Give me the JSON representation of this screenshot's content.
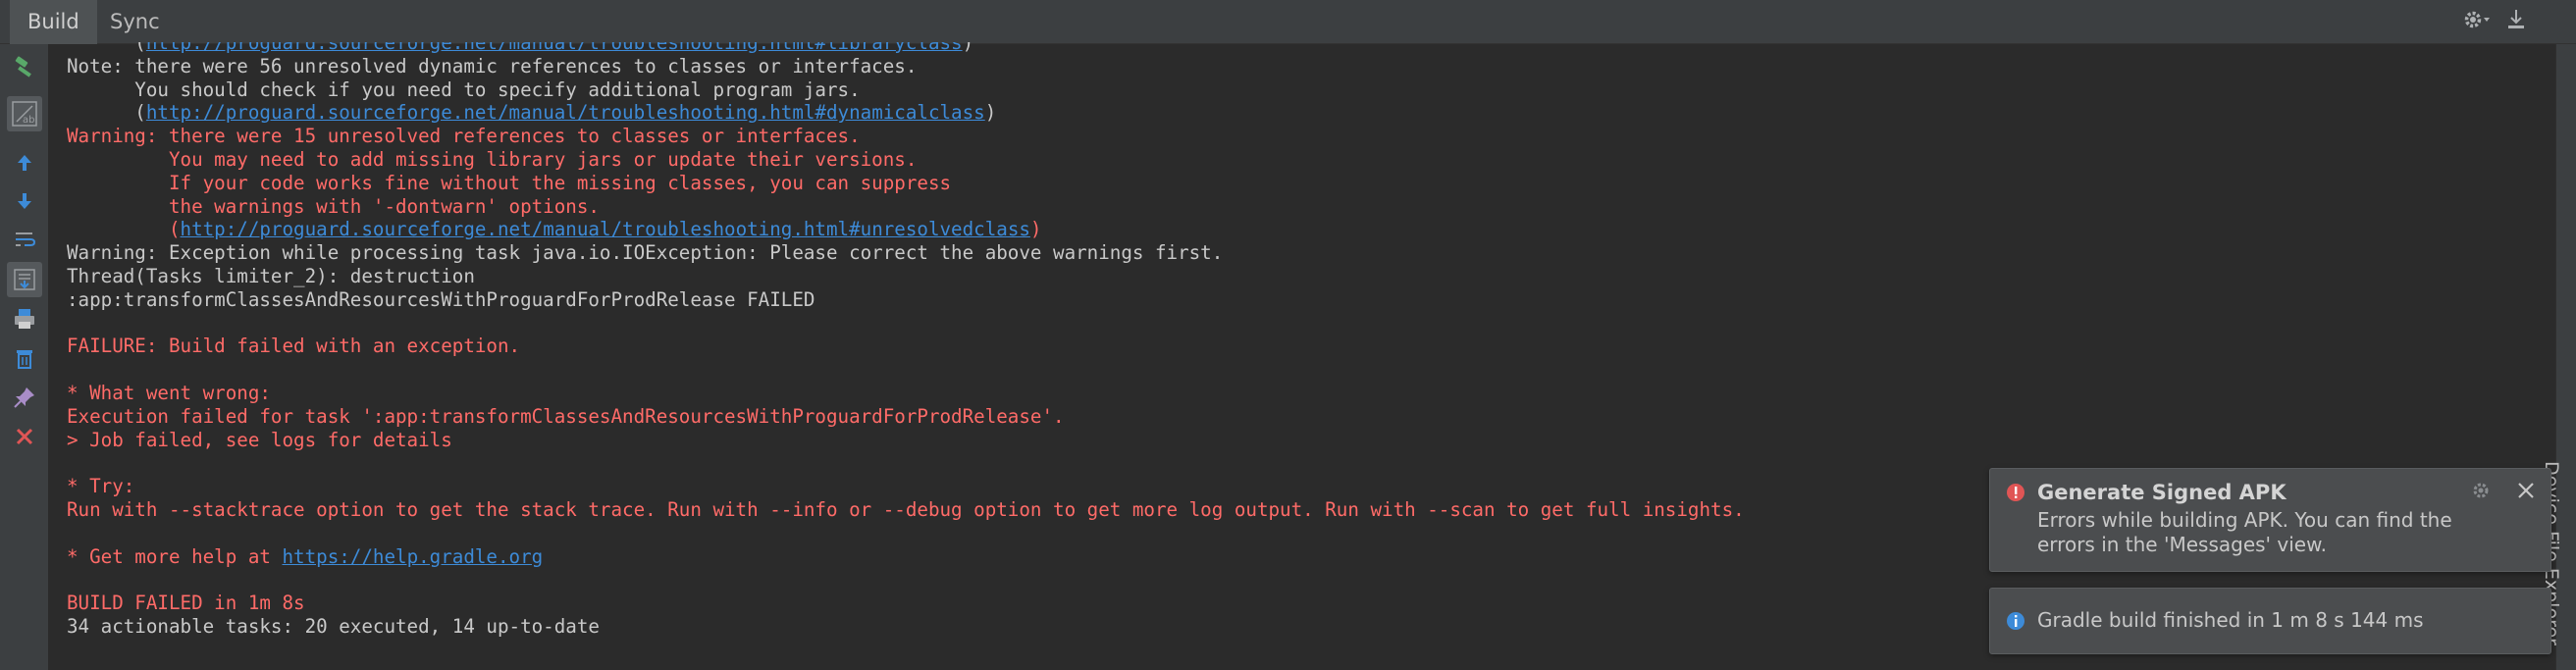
{
  "tabs": [
    {
      "label": "Build"
    },
    {
      "label": "Sync"
    }
  ],
  "top_icons": [
    "gear-icon",
    "hide-panel-icon"
  ],
  "toolbar_icons": [
    "hammer-icon",
    "toggle-view-icon",
    "up-arrow-icon",
    "down-arrow-icon",
    "soft-wrap-icon",
    "scroll-to-end-icon",
    "print-icon",
    "trash-icon",
    "pin-icon",
    "close-icon"
  ],
  "console": {
    "lines": [
      {
        "segments": [
          {
            "text": "      ("
          },
          {
            "text": "http://proguard.sourceforge.net/manual/troubleshooting.html#libraryclass",
            "link": true
          },
          {
            "text": ")"
          }
        ],
        "fade": true
      },
      {
        "segments": [
          {
            "text": "Note: there were 56 unresolved dynamic references to classes or interfaces."
          }
        ]
      },
      {
        "segments": [
          {
            "text": "      You should check if you need to specify additional program jars."
          }
        ]
      },
      {
        "segments": [
          {
            "text": "      ("
          },
          {
            "text": "http://proguard.sourceforge.net/manual/troubleshooting.html#dynamicalclass",
            "link": true
          },
          {
            "text": ")"
          }
        ]
      },
      {
        "color": "red",
        "segments": [
          {
            "text": "Warning: there were 15 unresolved references to classes or interfaces."
          }
        ]
      },
      {
        "color": "red",
        "segments": [
          {
            "text": "         You may need to add missing library jars or update their versions."
          }
        ]
      },
      {
        "color": "red",
        "segments": [
          {
            "text": "         If your code works fine without the missing classes, you can suppress"
          }
        ]
      },
      {
        "color": "red",
        "segments": [
          {
            "text": "         the warnings with '-dontwarn' options."
          }
        ]
      },
      {
        "color": "red",
        "segments": [
          {
            "text": "         ("
          },
          {
            "text": "http://proguard.sourceforge.net/manual/troubleshooting.html#unresolvedclass",
            "link": true
          },
          {
            "text": ")"
          }
        ]
      },
      {
        "segments": [
          {
            "text": "Warning: Exception while processing task java.io.IOException: Please correct the above warnings first."
          }
        ]
      },
      {
        "segments": [
          {
            "text": "Thread(Tasks limiter_2): destruction"
          }
        ]
      },
      {
        "segments": [
          {
            "text": ":app:transformClassesAndResourcesWithProguardForProdRelease FAILED"
          }
        ]
      },
      {
        "segments": [
          {
            "text": ""
          }
        ]
      },
      {
        "color": "red",
        "segments": [
          {
            "text": "FAILURE: Build failed with an exception."
          }
        ]
      },
      {
        "segments": [
          {
            "text": ""
          }
        ]
      },
      {
        "color": "red",
        "segments": [
          {
            "text": "* What went wrong:"
          }
        ]
      },
      {
        "color": "red",
        "segments": [
          {
            "text": "Execution failed for task ':app:transformClassesAndResourcesWithProguardForProdRelease'."
          }
        ]
      },
      {
        "color": "red",
        "segments": [
          {
            "text": "> Job failed, see logs for details"
          }
        ]
      },
      {
        "segments": [
          {
            "text": ""
          }
        ]
      },
      {
        "color": "red",
        "segments": [
          {
            "text": "* Try:"
          }
        ]
      },
      {
        "color": "red",
        "segments": [
          {
            "text": "Run with --stacktrace option to get the stack trace. Run with --info or --debug option to get more log output. Run with --scan to get full insights."
          }
        ]
      },
      {
        "segments": [
          {
            "text": ""
          }
        ]
      },
      {
        "color": "red",
        "segments": [
          {
            "text": "* Get more help at "
          },
          {
            "text": "https://help.gradle.org",
            "link": true
          }
        ]
      },
      {
        "segments": [
          {
            "text": ""
          }
        ]
      },
      {
        "color": "red",
        "segments": [
          {
            "text": "BUILD FAILED in 1m 8s"
          }
        ]
      },
      {
        "segments": [
          {
            "text": "34 actionable tasks: 20 executed, 14 up-to-date"
          }
        ]
      }
    ]
  },
  "right_strip": {
    "label": "Device File Explorer"
  },
  "notifications": {
    "signed_apk": {
      "title": "Generate Signed APK",
      "message": "Errors while building APK. You can find the errors in the 'Messages' view."
    },
    "gradle": {
      "message": "Gradle build finished in 1 m 8 s 144 ms"
    }
  },
  "colors": {
    "error_red": "#ff6b68",
    "link_blue": "#3d8bd8",
    "text": "#c9c9c9",
    "background": "#2b2b2b"
  }
}
